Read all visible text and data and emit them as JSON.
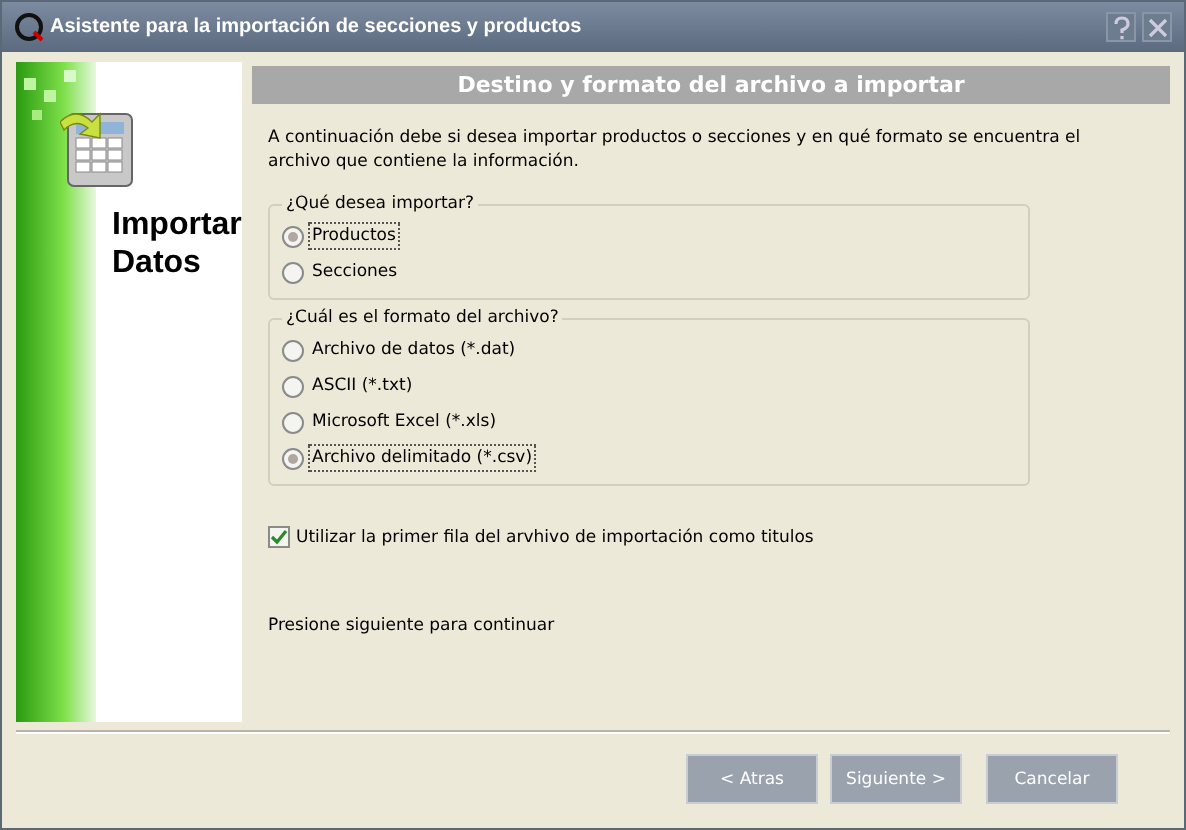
{
  "window": {
    "title": "Asistente para la importación de secciones y productos"
  },
  "sidebar": {
    "title_lines": [
      "Importar",
      "Datos"
    ]
  },
  "header": "Destino y formato del archivo a importar",
  "intro": "A continuación debe si desea importar productos o secciones y en qué formato se encuentra el archivo que contiene la información.",
  "groups": [
    {
      "legend": "¿Qué desea importar?",
      "options": [
        {
          "label": "Productos",
          "selected": true
        },
        {
          "label": "Secciones",
          "selected": false
        }
      ]
    },
    {
      "legend": "¿Cuál es el formato del archivo?",
      "options": [
        {
          "label": "Archivo de datos (*.dat)",
          "selected": false
        },
        {
          "label": "ASCII (*.txt)",
          "selected": false
        },
        {
          "label": "Microsoft Excel (*.xls)",
          "selected": false
        },
        {
          "label": "Archivo delimitado (*.csv)",
          "selected": true
        }
      ]
    }
  ],
  "checkbox": {
    "label": "Utilizar la primer fila del arvhivo de importación como titulos",
    "checked": true
  },
  "footer_note": "Presione siguiente para continuar",
  "buttons": [
    "< Atras",
    "Siguiente >",
    "Cancelar"
  ]
}
